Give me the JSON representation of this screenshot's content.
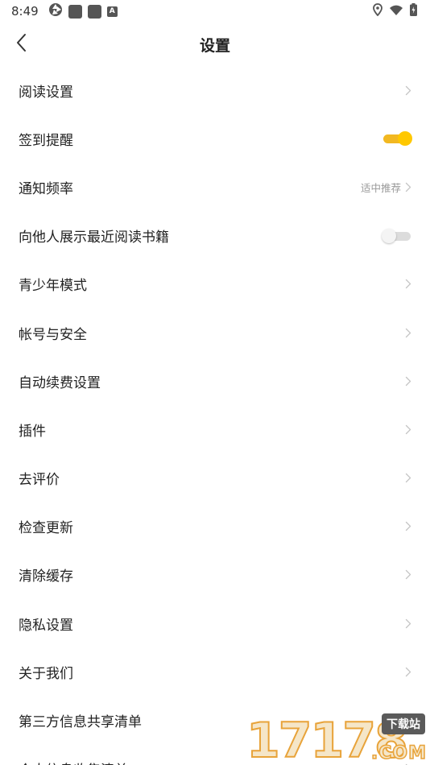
{
  "status_bar": {
    "time": "8:49",
    "left_icons": [
      "camera-aperture-icon",
      "app-notification-icon",
      "app-notification-icon",
      "a-notification-icon"
    ],
    "right_icons": [
      "location-icon",
      "wifi-icon",
      "battery-icon"
    ]
  },
  "header": {
    "title": "设置",
    "back_icon": "chevron-left-icon"
  },
  "colors": {
    "accent": "#ffc800",
    "accent_track": "#f2b821",
    "text_primary": "#222222",
    "text_secondary": "#999999",
    "chevron": "#c4c4c4"
  },
  "settings": [
    {
      "label": "阅读设置",
      "type": "link"
    },
    {
      "label": "签到提醒",
      "type": "toggle",
      "on": true
    },
    {
      "label": "通知频率",
      "type": "link",
      "value": "适中推荐"
    },
    {
      "label": "向他人展示最近阅读书籍",
      "type": "toggle",
      "on": false
    },
    {
      "label": "青少年模式",
      "type": "link"
    },
    {
      "label": "帐号与安全",
      "type": "link"
    },
    {
      "label": "自动续费设置",
      "type": "link"
    },
    {
      "label": "插件",
      "type": "link"
    },
    {
      "label": "去评价",
      "type": "link"
    },
    {
      "label": "检查更新",
      "type": "link"
    },
    {
      "label": "清除缓存",
      "type": "link"
    },
    {
      "label": "隐私设置",
      "type": "link"
    },
    {
      "label": "关于我们",
      "type": "link"
    },
    {
      "label": "第三方信息共享清单",
      "type": "link"
    },
    {
      "label": "个人信息收集清单",
      "type": "link"
    }
  ],
  "watermark": {
    "digits": "17178",
    "badge": "下载站",
    "domain": ".COM"
  }
}
